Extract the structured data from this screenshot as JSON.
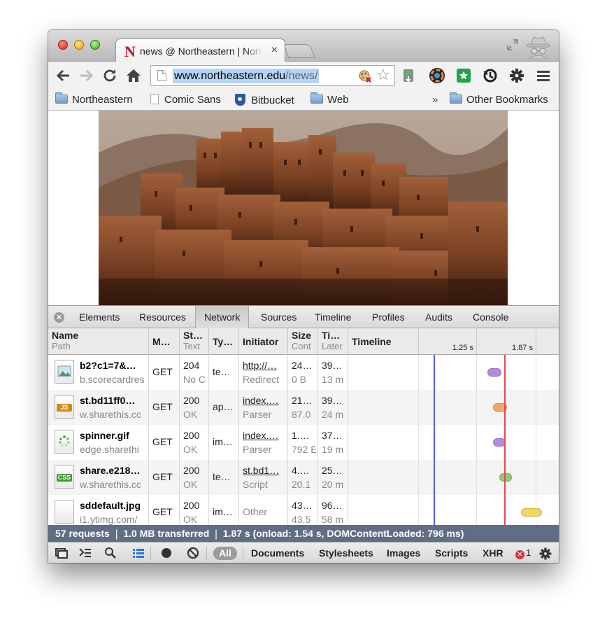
{
  "browser": {
    "tab": {
      "favicon": "N",
      "title": "news @ Northeastern | Northeastern University",
      "close": "×"
    },
    "url": {
      "host": "www.northeastern.edu",
      "path": "/news/"
    },
    "bookmarks": {
      "items": [
        {
          "label": "Northeastern",
          "icon": "folder-icon"
        },
        {
          "label": "Comic Sans",
          "icon": "page-icon"
        },
        {
          "label": "Bitbucket",
          "icon": "bitbucket-icon"
        },
        {
          "label": "Web",
          "icon": "folder-icon"
        }
      ],
      "overflow": "»",
      "other": "Other Bookmarks"
    }
  },
  "devtools": {
    "tabs": [
      "Elements",
      "Resources",
      "Network",
      "Sources",
      "Timeline",
      "Profiles",
      "Audits",
      "Console"
    ],
    "active_tab": "Network",
    "columns": {
      "name": "Name",
      "name_sub": "Path",
      "method": "M…",
      "status": "St…",
      "status_sub": "Text",
      "type": "Ty…",
      "initiator": "Initiator",
      "size": "Size",
      "size_sub": "Cont",
      "time": "Ti…",
      "time_sub": "Later",
      "timeline": "Timeline"
    },
    "timeline_ticks": [
      "1.25 s",
      "1.87 s"
    ],
    "rows": [
      {
        "name": "b2?c1=7&…",
        "path": "b.scorecardres",
        "method": "GET",
        "status": "204",
        "status_text": "No C",
        "type": "te…",
        "initiator": "http://…",
        "initiator_sub": "Redirect",
        "size": "24…",
        "content": "0 B",
        "time": "39…",
        "latency": "13 m",
        "file_icon": "image-file-icon",
        "bar_color": "#b48ae0"
      },
      {
        "name": "st.bd11ff0…",
        "path": "w.sharethis.cc",
        "method": "GET",
        "status": "200",
        "status_text": "OK",
        "type": "ap…",
        "initiator": "index.…",
        "initiator_sub": "Parser",
        "size": "21…",
        "content": "87.0",
        "time": "39…",
        "latency": "24 m",
        "file_icon": "js-file-icon",
        "bar_color": "#f0a868"
      },
      {
        "name": "spinner.gif",
        "path": "edge.sharethi",
        "method": "GET",
        "status": "200",
        "status_text": "OK",
        "type": "im…",
        "initiator": "index.…",
        "initiator_sub": "Parser",
        "size": "1.…",
        "content": "792 E",
        "time": "37…",
        "latency": "19 m",
        "file_icon": "gif-file-icon",
        "bar_color": "#b48ae0"
      },
      {
        "name": "share.e218…",
        "path": "w.sharethis.cc",
        "method": "GET",
        "status": "200",
        "status_text": "OK",
        "type": "te…",
        "initiator": "st.bd1…",
        "initiator_sub": "Script",
        "size": "4.…",
        "content": "20.1",
        "time": "25…",
        "latency": "20 m",
        "file_icon": "css-file-icon",
        "bar_color": "#8cca78"
      },
      {
        "name": "sddefault.jpg",
        "path": "i1.ytimg.com/",
        "method": "GET",
        "status": "200",
        "status_text": "OK",
        "type": "im…",
        "initiator": "Other",
        "initiator_sub": "",
        "size": "43…",
        "content": "43.5",
        "time": "96…",
        "latency": "58 m",
        "file_icon": "blank-file-icon",
        "bar_color": "#f0d858"
      }
    ],
    "summary": "57 requests  ❘  1.0 MB transferred  ❘  1.87 s (onload: 1.54 s, DOMContentLoaded: 796 ms)",
    "filters": {
      "all": "All",
      "items": [
        "Documents",
        "Stylesheets",
        "Images",
        "Scripts",
        "XHR"
      ]
    },
    "error_count": "1"
  },
  "colors": {
    "summary_bar": "#5f6d85",
    "dom_content_loaded_line": "#5a5ae6",
    "load_line": "#e64a4a",
    "url_selection": "#b3d3f7"
  }
}
